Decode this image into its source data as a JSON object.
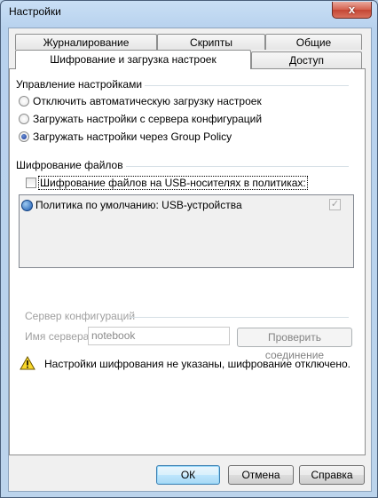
{
  "window": {
    "title": "Настройки",
    "close_glyph": "x"
  },
  "tabs": {
    "row1": [
      "Журналирование",
      "Скрипты",
      "Общие"
    ],
    "row2": [
      "Шифрование и загрузка настроек",
      "Доступ"
    ]
  },
  "settings_mgmt": {
    "title": "Управление настройками",
    "options": [
      "Отключить автоматическую загрузку настроек",
      "Загружать настройки с сервера конфигураций",
      "Загружать настройки через Group Policy"
    ]
  },
  "encryption": {
    "title": "Шифрование файлов",
    "checkbox_label": "Шифрование файлов на USB-носителях в политиках:",
    "policy_row": "Политика по умолчанию: USB-устройства"
  },
  "config_server": {
    "title": "Сервер конфигураций",
    "server_label": "Имя сервера:",
    "server_value": "notebook",
    "check_button": "Проверить соединение"
  },
  "warning": "Настройки шифрования не указаны, шифрование отключено.",
  "footer": {
    "ok": "ОК",
    "cancel": "Отмена",
    "help": "Справка"
  },
  "icons": [
    "close-icon",
    "globe-icon",
    "check-icon",
    "warning-icon"
  ]
}
